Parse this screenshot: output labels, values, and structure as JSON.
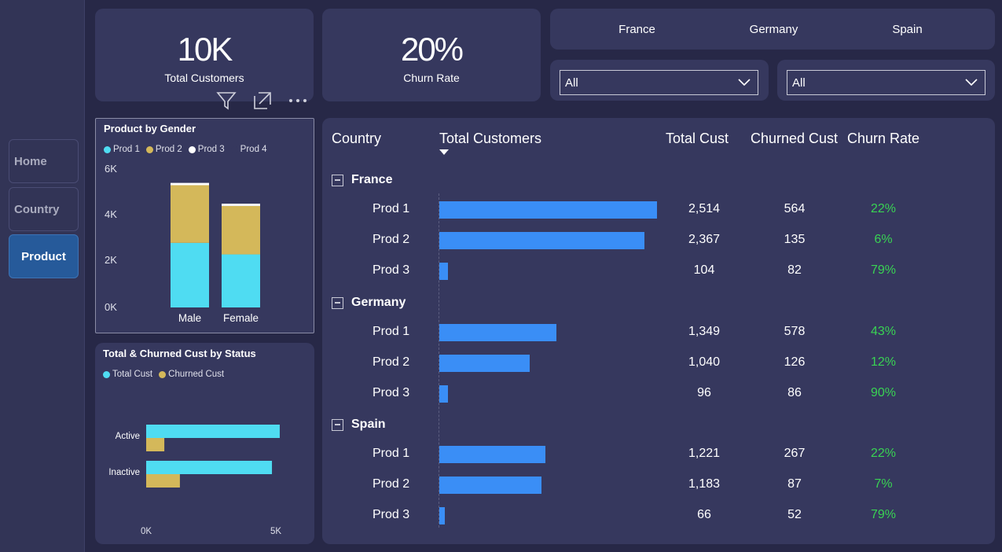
{
  "nav": {
    "home": "Home",
    "country": "Country",
    "product": "Product"
  },
  "kpis": {
    "total_customers": {
      "value": "10K",
      "label": "Total Customers"
    },
    "churn_rate": {
      "value": "20%",
      "label": "Churn Rate"
    }
  },
  "country_tabs": [
    "France",
    "Germany",
    "Spain"
  ],
  "filters": {
    "dropdown1": "All",
    "dropdown2": "All"
  },
  "icons": [
    "filter-icon",
    "focus-mode-icon",
    "more-options-icon"
  ],
  "gender_chart": {
    "title": "Product by Gender",
    "legend": [
      "Prod 1",
      "Prod 2",
      "Prod 3",
      "Prod 4"
    ],
    "y_ticks": [
      "6K",
      "4K",
      "2K",
      "0K"
    ],
    "categories": [
      "Male",
      "Female"
    ]
  },
  "status_chart": {
    "title": "Total & Churned Cust by Status",
    "legend": [
      "Total Cust",
      "Churned Cust"
    ],
    "categories": [
      "Active",
      "Inactive"
    ],
    "x_ticks": [
      "0K",
      "5K"
    ]
  },
  "colors": {
    "prod1": "#4fdcf2",
    "prod2": "#d4b85a",
    "prod3": "#ffffff",
    "prod4": "#36385e",
    "bar": "#3a8ef6",
    "rate": "#39d353"
  },
  "chart_data": [
    {
      "type": "bar",
      "stacked": true,
      "title": "Product by Gender",
      "categories": [
        "Male",
        "Female"
      ],
      "series": [
        {
          "name": "Prod 1",
          "values": [
            2800,
            2300
          ]
        },
        {
          "name": "Prod 2",
          "values": [
            2500,
            2100
          ]
        },
        {
          "name": "Prod 3",
          "values": [
            100,
            100
          ]
        },
        {
          "name": "Prod 4",
          "values": [
            0,
            0
          ]
        }
      ],
      "ylim": [
        0,
        6000
      ],
      "y_ticks": [
        "0K",
        "2K",
        "4K",
        "6K"
      ],
      "legend": "top-left"
    },
    {
      "type": "bar",
      "orientation": "horizontal",
      "title": "Total & Churned Cust by Status",
      "categories": [
        "Active",
        "Inactive"
      ],
      "series": [
        {
          "name": "Total Cust",
          "values": [
            5150,
            4850
          ]
        },
        {
          "name": "Churned Cust",
          "values": [
            700,
            1300
          ]
        }
      ],
      "xlim": [
        0,
        5000
      ],
      "x_ticks": [
        "0K",
        "5K"
      ],
      "legend": "top-left"
    },
    {
      "type": "table",
      "columns": [
        "Country",
        "Total Customers",
        "Total Cust",
        "Churned Cust",
        "Churn Rate"
      ],
      "groups": [
        {
          "name": "France",
          "rows": [
            {
              "label": "Prod 1",
              "value": 2514,
              "total": "2,514",
              "churned": "564",
              "rate": "22%"
            },
            {
              "label": "Prod 2",
              "value": 2367,
              "total": "2,367",
              "churned": "135",
              "rate": "6%"
            },
            {
              "label": "Prod 3",
              "value": 104,
              "total": "104",
              "churned": "82",
              "rate": "79%"
            }
          ]
        },
        {
          "name": "Germany",
          "rows": [
            {
              "label": "Prod 1",
              "value": 1349,
              "total": "1,349",
              "churned": "578",
              "rate": "43%"
            },
            {
              "label": "Prod 2",
              "value": 1040,
              "total": "1,040",
              "churned": "126",
              "rate": "12%"
            },
            {
              "label": "Prod 3",
              "value": 96,
              "total": "96",
              "churned": "86",
              "rate": "90%"
            }
          ]
        },
        {
          "name": "Spain",
          "rows": [
            {
              "label": "Prod 1",
              "value": 1221,
              "total": "1,221",
              "churned": "267",
              "rate": "22%"
            },
            {
              "label": "Prod 2",
              "value": 1183,
              "total": "1,183",
              "churned": "87",
              "rate": "7%"
            },
            {
              "label": "Prod 3",
              "value": 66,
              "total": "66",
              "churned": "52",
              "rate": "79%"
            }
          ]
        }
      ]
    }
  ]
}
